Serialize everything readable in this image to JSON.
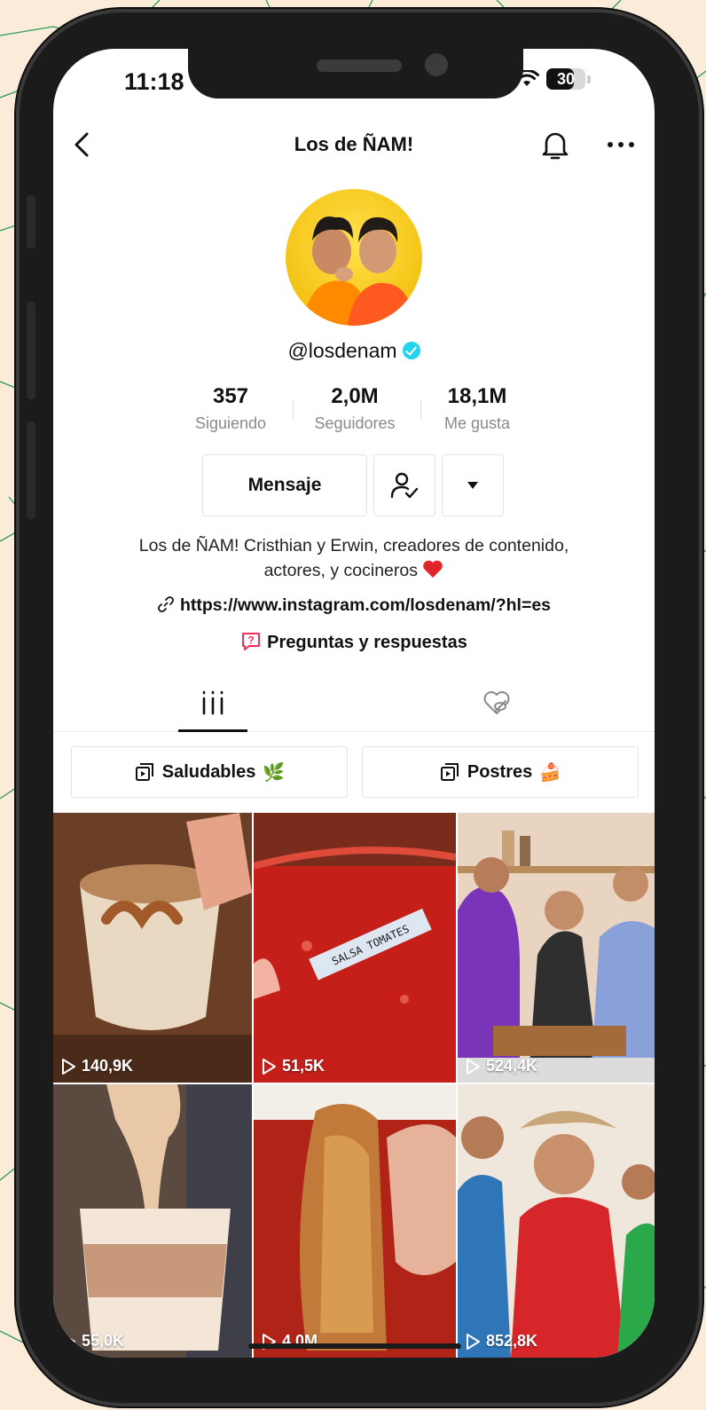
{
  "status_bar": {
    "time": "11:18",
    "battery": "30"
  },
  "nav": {
    "title": "Los de ÑAM!"
  },
  "profile": {
    "handle": "@losdenam",
    "stats": [
      {
        "value": "357",
        "label": "Siguiendo"
      },
      {
        "value": "2,0M",
        "label": "Seguidores"
      },
      {
        "value": "18,1M",
        "label": "Me gusta"
      }
    ],
    "message_button": "Mensaje",
    "bio_line1": "Los de ÑAM! Cristhian y Erwin, creadores de contenido,",
    "bio_line2": "actores, y cocineros",
    "link": "https://www.instagram.com/losdenam/?hl=es",
    "qa": "Preguntas y respuestas"
  },
  "playlists": [
    {
      "label": "Saludables",
      "emoji": "🌿"
    },
    {
      "label": "Postres",
      "emoji": "🍰"
    }
  ],
  "videos": [
    {
      "views": "140,9K"
    },
    {
      "views": "51,5K",
      "caption": "SALSA TOMATES"
    },
    {
      "views": "524,4K"
    },
    {
      "views": "55,0K"
    },
    {
      "views": "4,0M"
    },
    {
      "views": "852,8K"
    }
  ],
  "colors": {
    "verified": "#20d5ec",
    "qa_icon": "#fe2c55",
    "heart": "#e0262a"
  }
}
